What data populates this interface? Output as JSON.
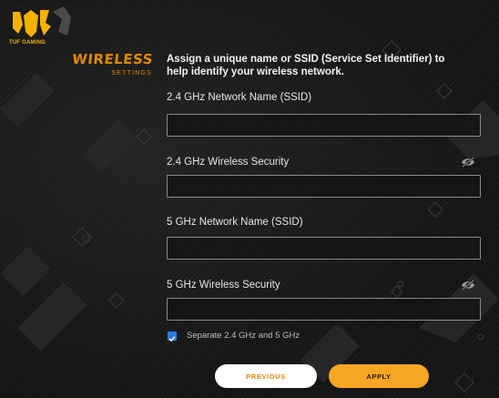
{
  "brand": {
    "logo_text": "TUF GAMING"
  },
  "section": {
    "title": "WIRELESS",
    "subtitle": "SETTINGS"
  },
  "description": "Assign a unique name or SSID (Service Set Identifier) to help identify your wireless network.",
  "fields": {
    "ssid_24": {
      "label": "2.4 GHz Network Name (SSID)",
      "value": ""
    },
    "security_24": {
      "label": "2.4 GHz Wireless Security",
      "value": "",
      "icon": "eye-off-icon"
    },
    "ssid_5": {
      "label": "5 GHz Network Name (SSID)",
      "value": ""
    },
    "security_5": {
      "label": "5 GHz Wireless Security",
      "value": "",
      "icon": "eye-off-icon"
    }
  },
  "separate_bands": {
    "label": "Separate 2.4 GHz and 5 GHz",
    "checked": true
  },
  "buttons": {
    "previous": "PREVIOUS",
    "apply": "APPLY"
  },
  "colors": {
    "accent": "#e08a00",
    "apply_bg": "#f5a623",
    "checkbox": "#2d7be0",
    "background": "#141414"
  }
}
